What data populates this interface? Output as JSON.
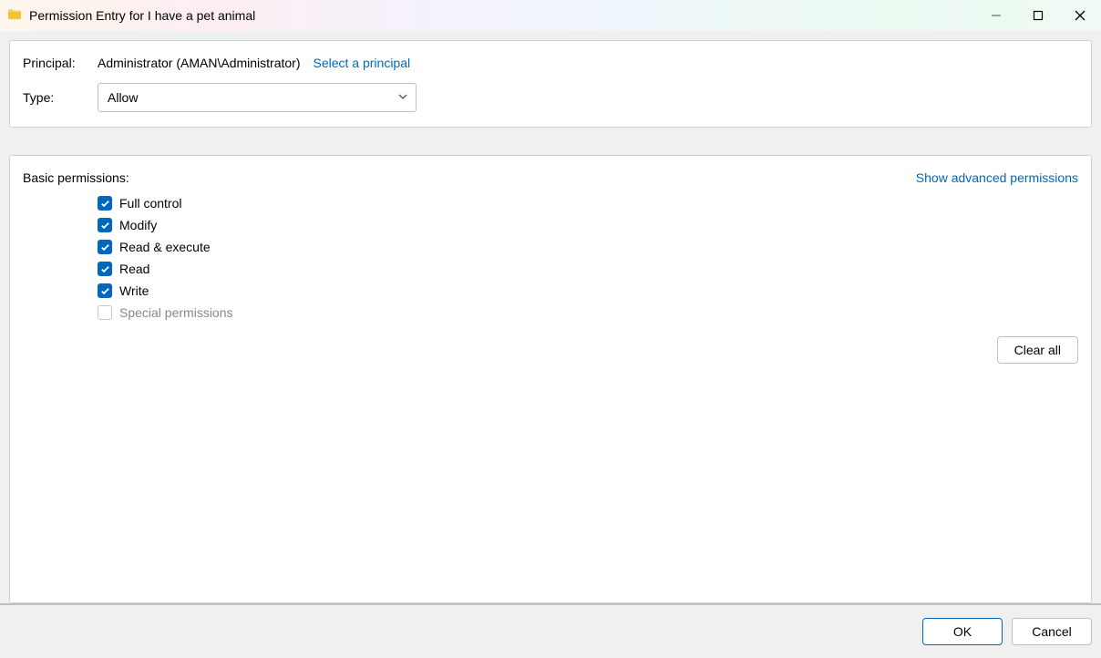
{
  "window": {
    "title": "Permission Entry for I have a pet animal"
  },
  "principal": {
    "label": "Principal:",
    "value": "Administrator (AMAN\\Administrator)",
    "select_link": "Select a principal"
  },
  "type": {
    "label": "Type:",
    "selected": "Allow"
  },
  "permissions": {
    "section_label": "Basic permissions:",
    "show_advanced_label": "Show advanced permissions",
    "items": [
      {
        "label": "Full control",
        "checked": true,
        "enabled": true
      },
      {
        "label": "Modify",
        "checked": true,
        "enabled": true
      },
      {
        "label": "Read & execute",
        "checked": true,
        "enabled": true
      },
      {
        "label": "Read",
        "checked": true,
        "enabled": true
      },
      {
        "label": "Write",
        "checked": true,
        "enabled": true
      },
      {
        "label": "Special permissions",
        "checked": false,
        "enabled": false
      }
    ],
    "clear_all_label": "Clear all"
  },
  "footer": {
    "ok_label": "OK",
    "cancel_label": "Cancel"
  }
}
